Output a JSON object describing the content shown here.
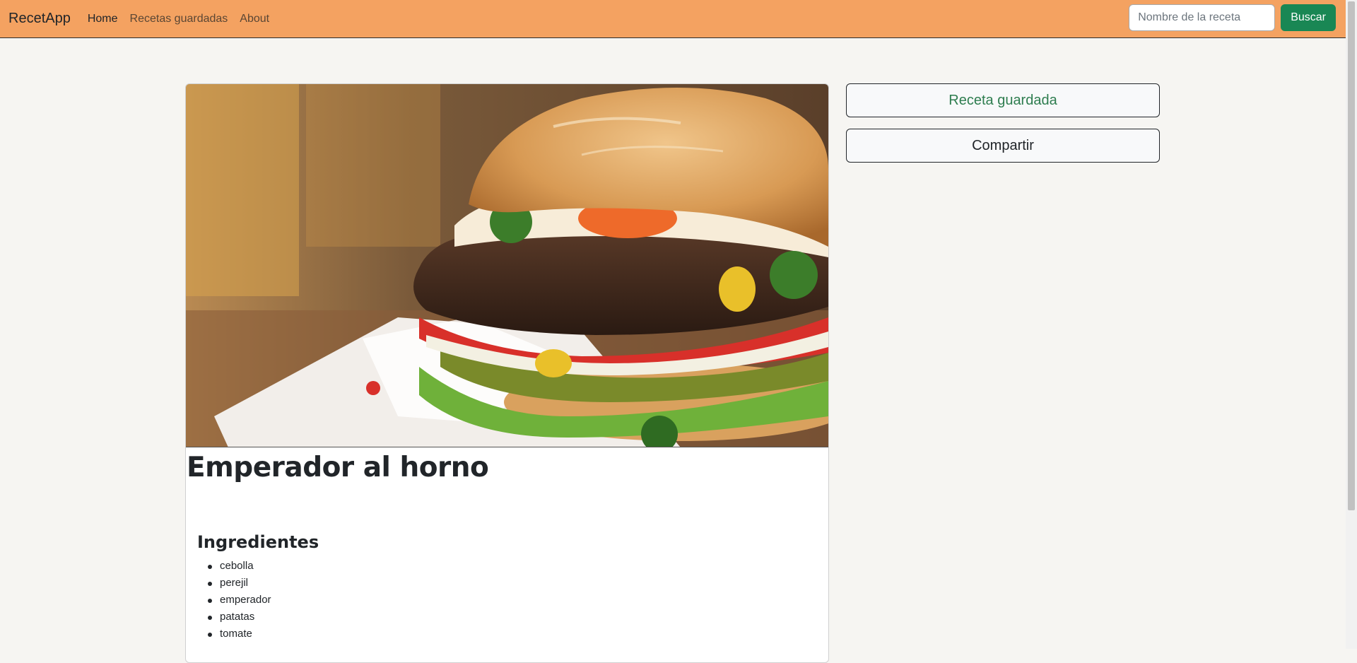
{
  "navbar": {
    "brand": "RecetApp",
    "links": [
      {
        "label": "Home",
        "active": true
      },
      {
        "label": "Recetas guardadas",
        "active": false
      },
      {
        "label": "About",
        "active": false
      }
    ],
    "search": {
      "placeholder": "Nombre de la receta",
      "value": "",
      "button_label": "Buscar"
    },
    "background_color": "#f4a261"
  },
  "recipe": {
    "image": "burger-photo",
    "title": "Emperador al horno",
    "ingredients_heading": "Ingredientes",
    "ingredients": [
      "cebolla",
      "perejil",
      "emperador",
      "patatas",
      "tomate"
    ]
  },
  "actions": {
    "saved_label": "Receta guardada",
    "share_label": "Compartir"
  },
  "colors": {
    "accent_green": "#198754",
    "saved_text": "#2e7d4f",
    "page_background": "#f6f5f2"
  }
}
